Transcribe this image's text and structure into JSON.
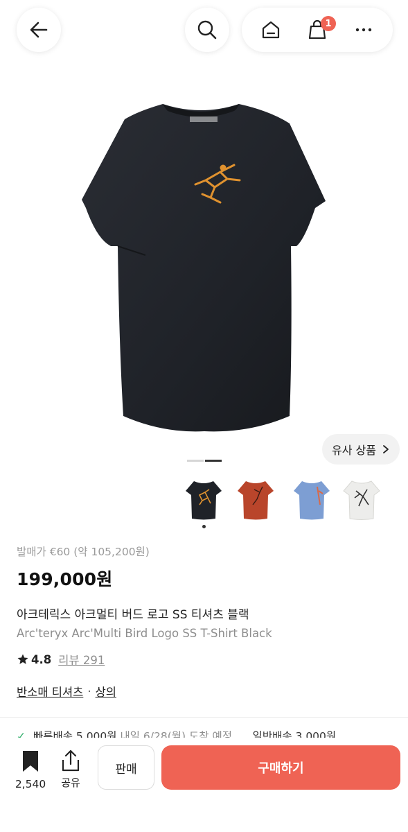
{
  "header": {
    "back_icon": "back-arrow-icon",
    "search_icon": "search-icon",
    "home_icon": "home-icon",
    "cart_icon": "shopping-bag-icon",
    "cart_badge": "1",
    "more_icon": "more-icon"
  },
  "gallery": {
    "similar_label": "유사 상품",
    "thumbnails": [
      {
        "color_hex": "#1f2228"
      },
      {
        "color_hex": "#b9452b"
      },
      {
        "color_hex": "#7d9ed3"
      },
      {
        "color_hex": "#ededeb"
      }
    ]
  },
  "product": {
    "release_price": "발매가 €60 (약 105,200원)",
    "price": "199,000원",
    "name_ko": "아크테릭스 아크멀티 버드 로고 SS 티셔츠 블랙",
    "name_en": "Arc'teryx Arc'Multi Bird Logo SS T-Shirt Black",
    "rating": "4.8",
    "reviews": "리뷰 291",
    "categories": [
      "반소매 티셔츠",
      "상의"
    ],
    "category_sep": "·"
  },
  "delivery": {
    "fast": "빠른배송 5,000원",
    "fast_eta": "내일 6/28(월) 도착 예정",
    "normal": "일반배송 3,000원"
  },
  "bottom_bar": {
    "save_count": "2,540",
    "share_label": "공유",
    "sell_label": "판매",
    "buy_label": "구매하기"
  },
  "colors": {
    "accent": "#ef6354",
    "shirt": "#1f2228",
    "logo": "#e0922f"
  }
}
